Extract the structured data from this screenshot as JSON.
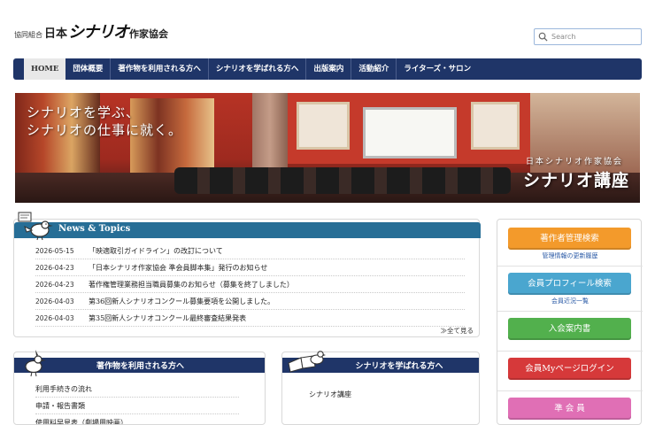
{
  "header": {
    "logo_prefix": "協同組合",
    "logo_a": "日本",
    "logo_b": "シナリオ",
    "logo_c": "作家協会",
    "search_placeholder": "Search"
  },
  "nav": {
    "items": [
      "HOME",
      "団体概要",
      "著作物を利用される方へ",
      "シナリオを学ばれる方へ",
      "出版案内",
      "活動紹介",
      "ライターズ・サロン"
    ]
  },
  "hero": {
    "copy_line1": "シナリオを学ぶ、",
    "copy_line2": "シナリオの仕事に就く。",
    "org": "日本シナリオ作家協会",
    "course": "シナリオ講座"
  },
  "news": {
    "title": "News & Topics",
    "items": [
      {
        "date": "2026-05-15",
        "text": "「映適取引ガイドライン」の改訂について"
      },
      {
        "date": "2026-04-23",
        "text": "「日本シナリオ作家協会 準会員脚本集」発行のお知らせ"
      },
      {
        "date": "2026-04-23",
        "text": "著作権管理業務担当職員募集のお知らせ（募集を終了しました）"
      },
      {
        "date": "2026-04-03",
        "text": "第36回新人シナリオコンクール募集要項を公開しました。"
      },
      {
        "date": "2026-04-03",
        "text": "第35回新人シナリオコンクール最終審査結果発表"
      }
    ],
    "more": "≫全て見る"
  },
  "usage_panel": {
    "title": "著作物を利用される方へ",
    "links": [
      "利用手続きの流れ",
      "申請・報告書類",
      "使用料早見表（劇場用映画）"
    ]
  },
  "learn_panel": {
    "title": "シナリオを学ばれる方へ",
    "links": [
      "シナリオ講座"
    ]
  },
  "side": {
    "buttons": [
      {
        "label": "著作者管理検索",
        "sub": "管理情報の更新履歴",
        "color": "#f39a2b"
      },
      {
        "label": "会員プロフィール検索",
        "sub": "会員近況一覧",
        "color": "#4aa6cf"
      },
      {
        "label": "入会案内書",
        "sub": "",
        "color": "#52b04d"
      },
      {
        "label": "会員Myページログイン",
        "sub": "",
        "color": "#d6393a"
      },
      {
        "label": "準 会 員",
        "sub": "",
        "color": "#e06fb5"
      }
    ]
  }
}
